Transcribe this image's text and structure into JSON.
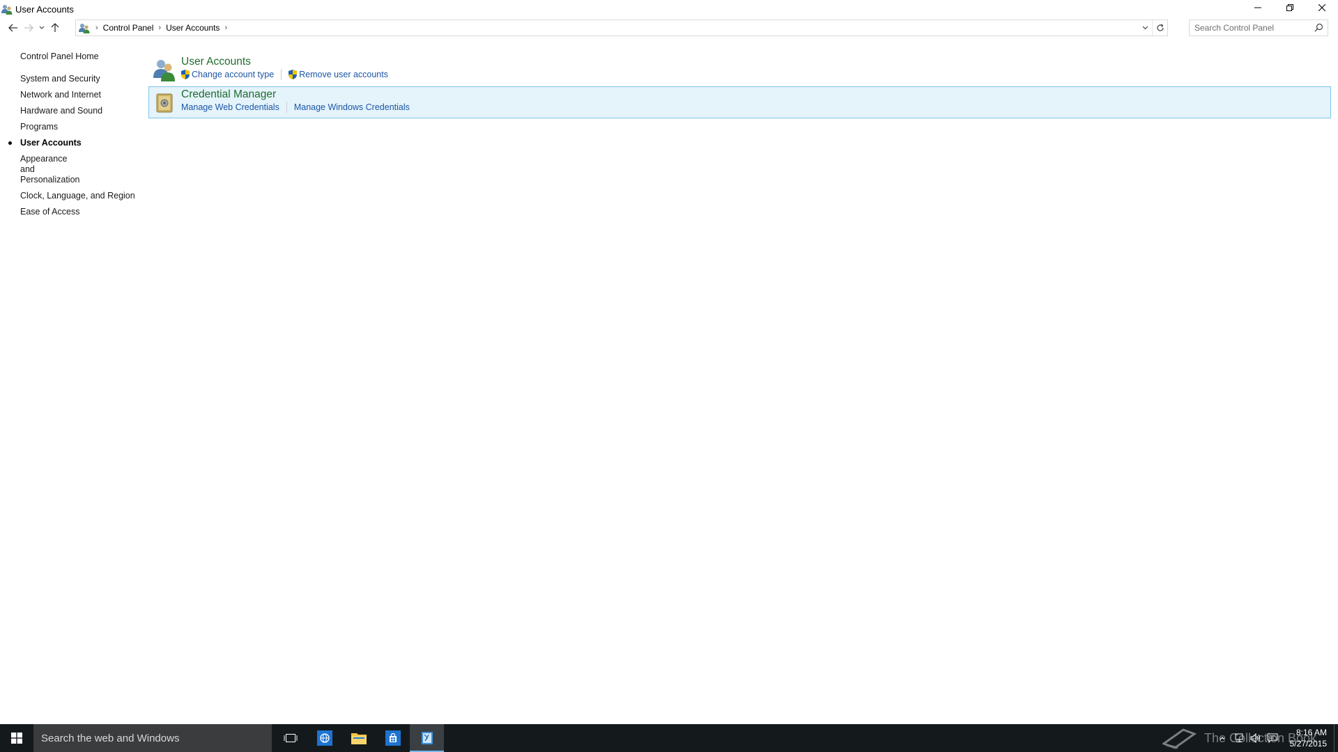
{
  "window": {
    "title": "User Accounts",
    "icon": "user-accounts-icon"
  },
  "navigation": {
    "breadcrumb": [
      "Control Panel",
      "User Accounts"
    ]
  },
  "search": {
    "placeholder": "Search Control Panel"
  },
  "sidebar": {
    "home_label": "Control Panel Home",
    "items": [
      {
        "label": "System and Security"
      },
      {
        "label": "Network and Internet"
      },
      {
        "label": "Hardware and Sound"
      },
      {
        "label": "Programs"
      },
      {
        "label": "User Accounts",
        "active": true
      },
      {
        "label": "Appearance and Personalization"
      },
      {
        "label": "Clock, Language, and Region"
      },
      {
        "label": "Ease of Access"
      }
    ]
  },
  "categories": [
    {
      "title": "User Accounts",
      "icon": "users-icon",
      "links": [
        {
          "label": "Change account type",
          "shield": true
        },
        {
          "label": "Remove user accounts",
          "shield": true
        }
      ]
    },
    {
      "title": "Credential Manager",
      "icon": "credential-vault-icon",
      "highlighted": true,
      "links": [
        {
          "label": "Manage Web Credentials",
          "shield": false
        },
        {
          "label": "Manage Windows Credentials",
          "shield": false
        }
      ]
    }
  ],
  "taskbar": {
    "search_placeholder": "Search the web and Windows",
    "watermark": "The Collection Book",
    "time": "8:16 AM",
    "date": "5/27/2015"
  },
  "colors": {
    "category_title": "#1e6c2e",
    "link": "#1b56a5",
    "highlight_bg": "#e5f3fb",
    "highlight_border": "#7fc4ea",
    "taskbar": "#14191c"
  }
}
